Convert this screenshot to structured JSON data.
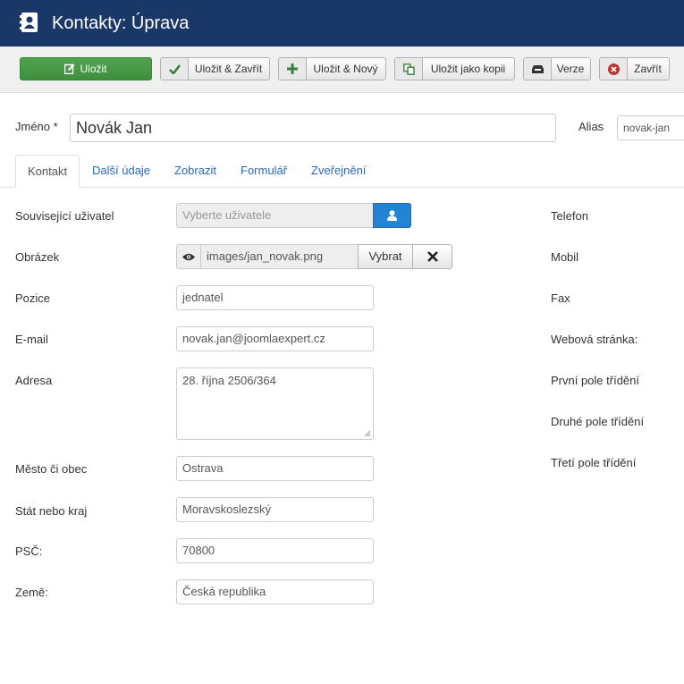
{
  "header": {
    "title": "Kontakty: Úprava",
    "icon": "address-book-icon"
  },
  "toolbar": {
    "save": "Uložit",
    "save_close": "Uložit & Zavřít",
    "save_new": "Uložit & Nový",
    "save_copy": "Uložit jako kopii",
    "versions": "Verze",
    "close": "Zavřít"
  },
  "name_field": {
    "label": "Jméno *",
    "value": "Novák Jan"
  },
  "alias_field": {
    "label": "Alias",
    "value": "novak-jan"
  },
  "tabs": [
    "Kontakt",
    "Další údaje",
    "Zobrazit",
    "Formulář",
    "Zveřejnění"
  ],
  "form": {
    "linked_user": {
      "label": "Související uživatel",
      "placeholder": "Vyberte uživatele"
    },
    "image": {
      "label": "Obrázek",
      "value": "images/jan_novak.png",
      "select_label": "Vybrat"
    },
    "position": {
      "label": "Pozice",
      "value": "jednatel"
    },
    "email": {
      "label": "E-mail",
      "value": "novak.jan@joomlaexpert.cz"
    },
    "address": {
      "label": "Adresa",
      "value": "28. října 2506/364"
    },
    "city": {
      "label": "Město či obec",
      "value": "Ostrava"
    },
    "state": {
      "label": "Stát nebo kraj",
      "value": "Moravskoslezský"
    },
    "zip": {
      "label": "PSČ:",
      "value": "70800"
    },
    "country": {
      "label": "Země:",
      "value": "Česká republika"
    }
  },
  "right_labels": {
    "phone": "Telefon",
    "mobile": "Mobil",
    "fax": "Fax",
    "website": "Webová stránka:",
    "sort1": "První pole třídění",
    "sort2": "Druhé pole třídění",
    "sort3": "Třetí pole třídění"
  },
  "colors": {
    "header_bg": "#1a3867",
    "save_green": "#46a046",
    "link_blue": "#2a69b8",
    "user_button_blue": "#2384d3",
    "close_red": "#bd362f"
  }
}
